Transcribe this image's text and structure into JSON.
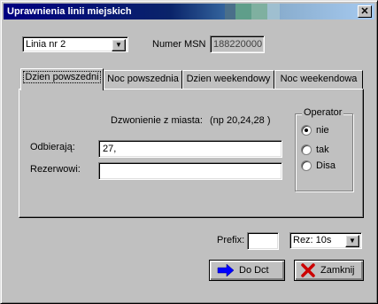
{
  "window": {
    "title": "Uprawnienia linii miejskich",
    "close_glyph": "✕"
  },
  "top": {
    "line_select": {
      "value": "Linia nr 2",
      "arrow": "▼"
    },
    "msn_label": "Numer MSN",
    "msn_value": "188220000"
  },
  "tabs": [
    {
      "label": "Dzien powszedni",
      "active": true
    },
    {
      "label": "Noc powszednia",
      "active": false
    },
    {
      "label": "Dzien weekendowy",
      "active": false
    },
    {
      "label": "Noc weekendowa",
      "active": false
    }
  ],
  "panel": {
    "calling_label": "Dzwonienie z miasta:",
    "hint": "(np 20,24,28 )",
    "receiving_label": "Odbierają:",
    "receiving_value": "27,",
    "reserve_label": "Rezerwowi:",
    "reserve_value": "",
    "operator": {
      "label": "Operator",
      "options": [
        {
          "label": "nie",
          "selected": true
        },
        {
          "label": "tak",
          "selected": false
        },
        {
          "label": "Disa",
          "selected": false
        }
      ]
    }
  },
  "bottom": {
    "prefix_label": "Prefix:",
    "prefix_value": "",
    "rez_select": {
      "value": "Rez: 10s",
      "arrow": "▼"
    },
    "do_dct_label": "Do Dct",
    "close_label": "Zamknij"
  },
  "colors": {
    "title_start": "#000080",
    "face": "#c0c0c0",
    "arrow_icon": "#0000ff",
    "x_icon": "#cc0000"
  },
  "icons": {
    "do_dct": "arrow-right-icon",
    "zamknij": "red-x-icon"
  }
}
